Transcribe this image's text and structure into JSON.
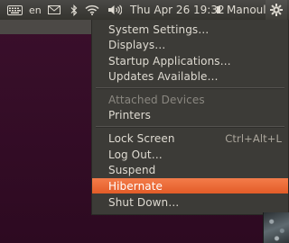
{
  "topbar": {
    "keyboard_lang": "en",
    "clock": "Thu Apr 26 19:32",
    "user": "Manoul"
  },
  "icons": {
    "keyboard": "keyboard-icon",
    "mail": "mail-icon",
    "bluetooth": "bluetooth-icon",
    "wifi": "wifi-icon",
    "volume": "volume-icon",
    "user": "user-icon",
    "gear": "gear-icon"
  },
  "menu": {
    "items": [
      {
        "label": "System Settings…"
      },
      {
        "label": "Displays…"
      },
      {
        "label": "Startup Applications…"
      },
      {
        "label": "Updates Available…"
      },
      {
        "label": "Attached Devices"
      },
      {
        "label": "Printers"
      },
      {
        "label": "Lock Screen",
        "shortcut": "Ctrl+Alt+L"
      },
      {
        "label": "Log Out…"
      },
      {
        "label": "Suspend"
      },
      {
        "label": "Hibernate"
      },
      {
        "label": "Shut Down…"
      }
    ],
    "highlighted": "Hibernate",
    "highlight_color": "#f06f3c"
  },
  "colors": {
    "panel": "#3c3b37",
    "desktop": "#2c0a20",
    "accent": "#e95420"
  }
}
